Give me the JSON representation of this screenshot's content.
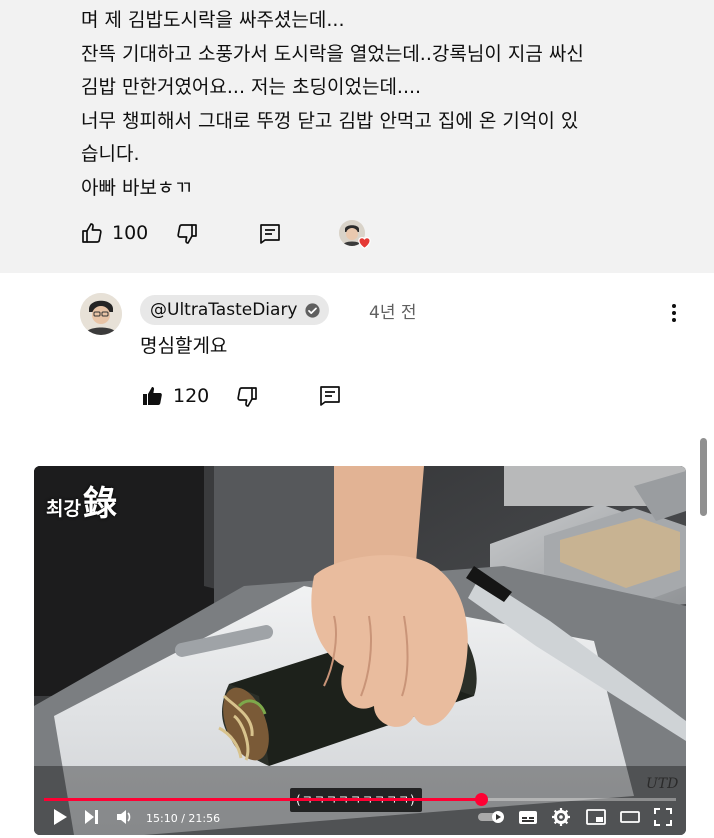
{
  "top_comment": {
    "lines": [
      "며 제 김밥도시락을 싸주셨는데...",
      "잔뜩 기대하고 소풍가서 도시락을 열었는데..강록님이 지금 싸신",
      "김밥 만한거였어요... 저는 초딩이었는데....",
      "너무 챙피해서 그대로 뚜껑 닫고 김밥 안먹고 집에 온 기억이 있",
      "습니다.",
      "아빠 바보ㅎㄲ"
    ],
    "like_count": "100"
  },
  "reply": {
    "handle": "@UltraTasteDiary",
    "time": "4년 전",
    "text": "명심할게요",
    "like_count": "120"
  },
  "video": {
    "channel_logo_small": "최강",
    "channel_logo_big": "錄",
    "watermark": "UTD",
    "caption": "(ㅋㅋㅋㅋㅋㅋㅋㅋㅋ)",
    "time_display": "15:10 / 21:56",
    "progress": 0.6913
  },
  "colors": {
    "highlight_bg": "#f2f2f2",
    "progress_red": "#ff0033",
    "heart_red": "#e53935"
  },
  "icons": {
    "like": "thumb-up-icon",
    "dislike": "thumb-down-icon",
    "reply": "comment-icon",
    "verified": "verified-check-icon",
    "more": "kebab-menu-icon"
  }
}
